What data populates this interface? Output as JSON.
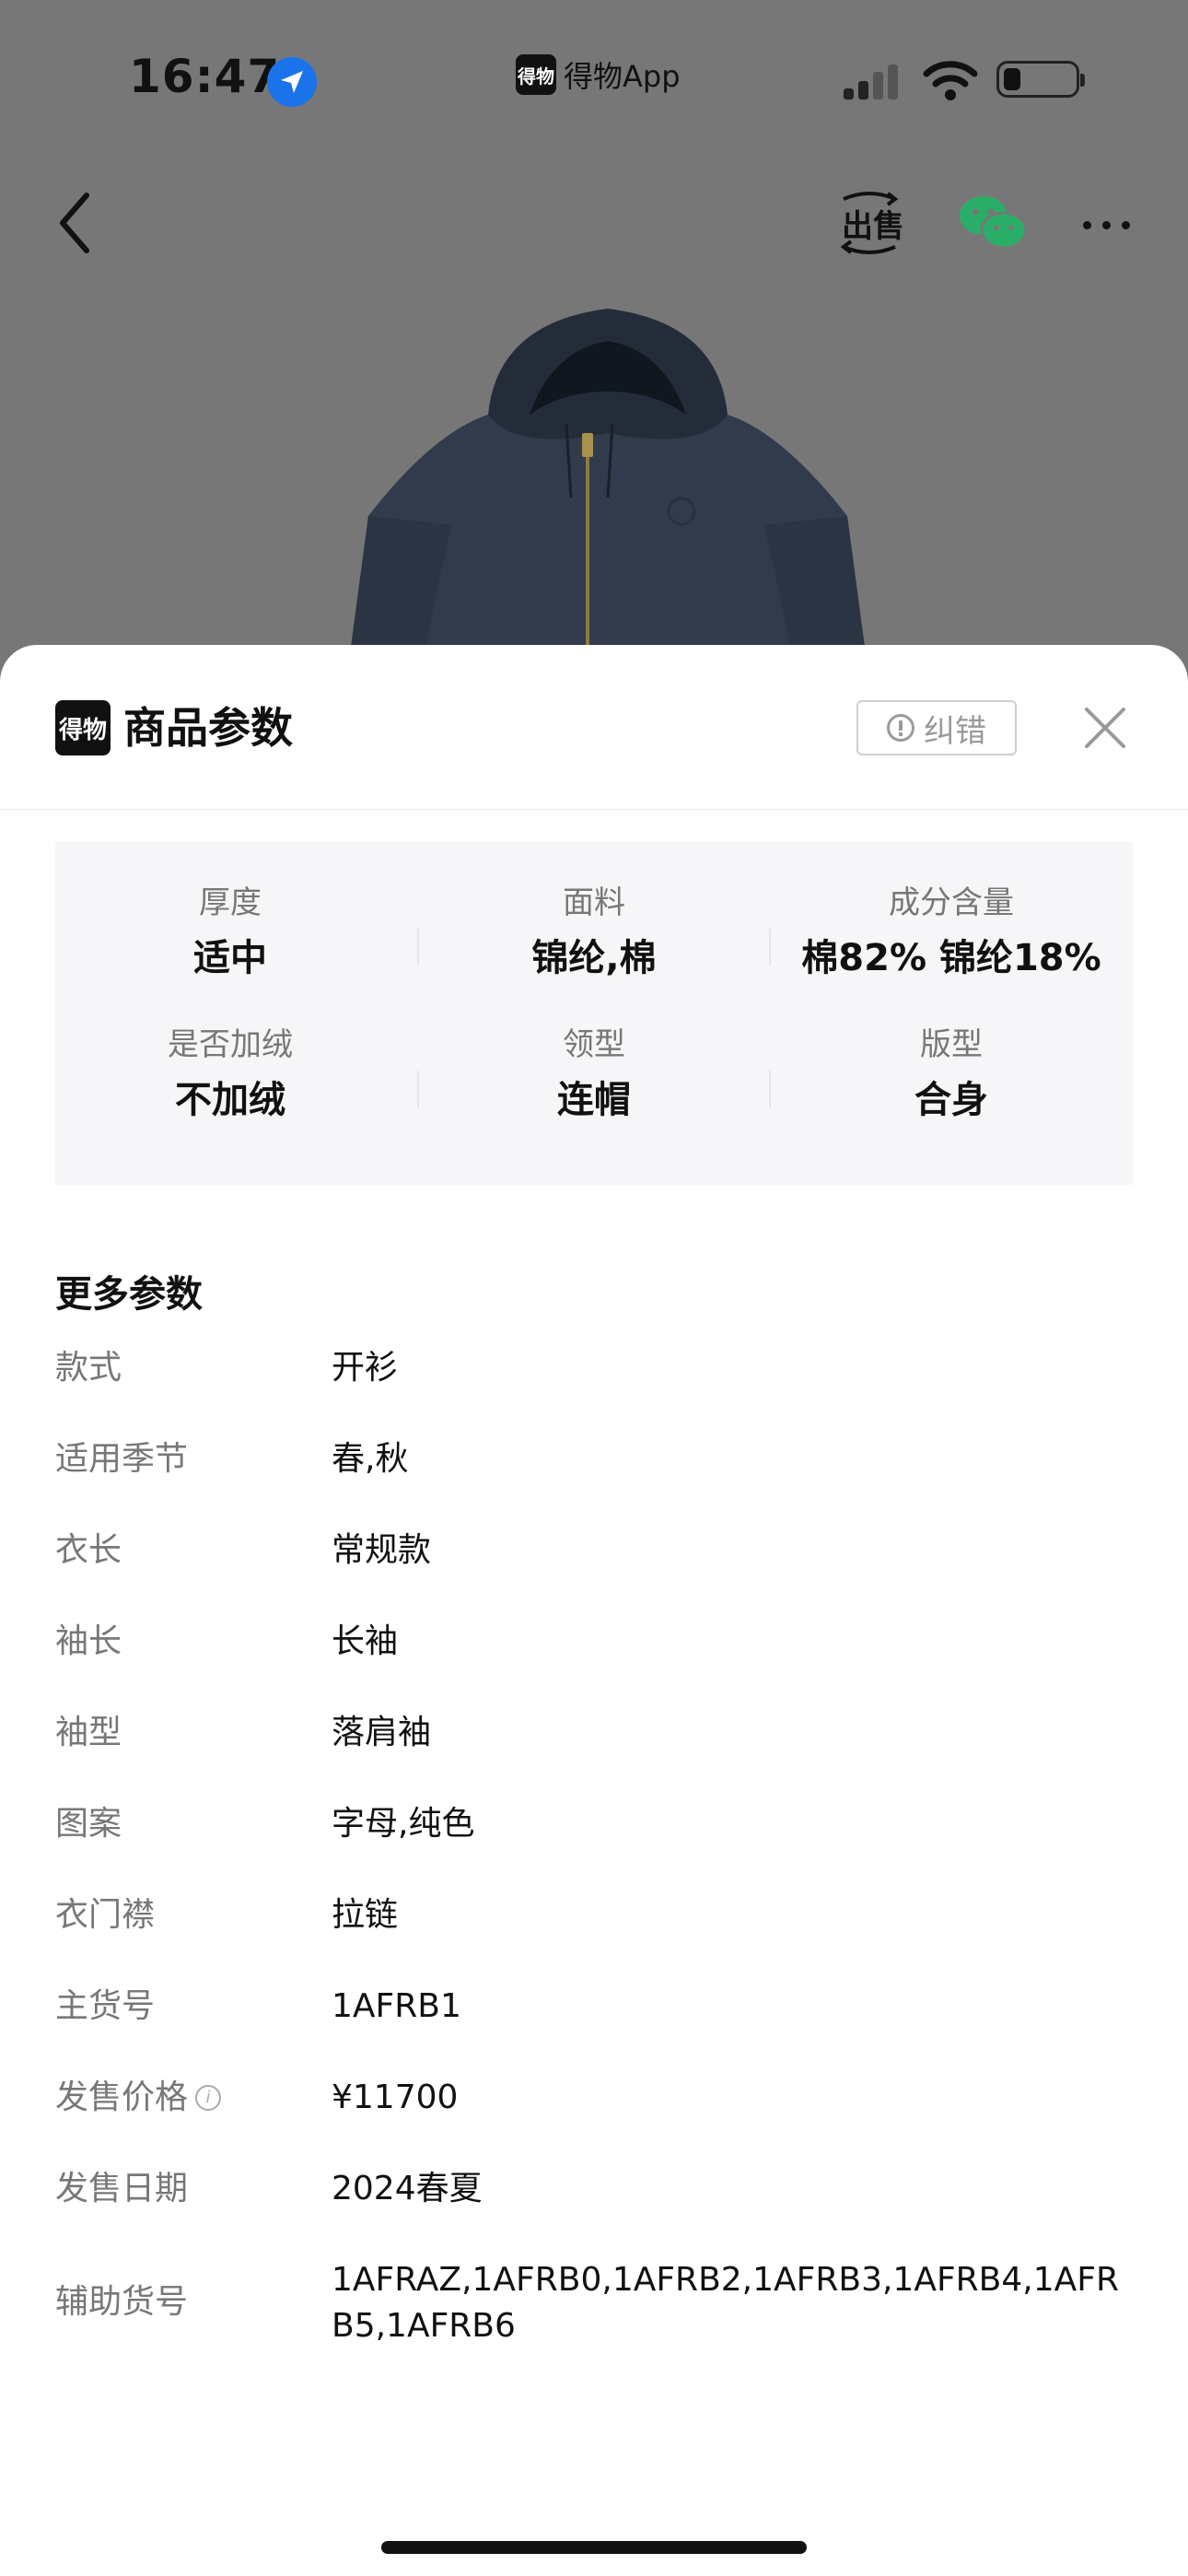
{
  "status_bar": {
    "time": "16:47",
    "app_badge_icon": "得物",
    "app_badge": "得物App"
  },
  "nav": {
    "sell_label": "出售"
  },
  "sheet": {
    "logo": "得物",
    "title": "商品参数",
    "report_label": "纠错"
  },
  "key_params": [
    {
      "label": "厚度",
      "value": "适中"
    },
    {
      "label": "面料",
      "value": "锦纶,棉"
    },
    {
      "label": "成分含量",
      "value": "棉82% 锦纶18%"
    },
    {
      "label": "是否加绒",
      "value": "不加绒"
    },
    {
      "label": "领型",
      "value": "连帽"
    },
    {
      "label": "版型",
      "value": "合身"
    }
  ],
  "more_title": "更多参数",
  "more_params": [
    {
      "label": "款式",
      "value": "开衫"
    },
    {
      "label": "适用季节",
      "value": "春,秋"
    },
    {
      "label": "衣长",
      "value": "常规款"
    },
    {
      "label": "袖长",
      "value": "长袖"
    },
    {
      "label": "袖型",
      "value": "落肩袖"
    },
    {
      "label": "图案",
      "value": "字母,纯色"
    },
    {
      "label": "衣门襟",
      "value": "拉链"
    },
    {
      "label": "主货号",
      "value": "1AFRB1"
    },
    {
      "label": "发售价格",
      "value": "¥11700"
    },
    {
      "label": "发售日期",
      "value": "2024春夏"
    },
    {
      "label": "辅助货号",
      "value": "1AFRAZ,1AFRB0,1AFRB2,1AFRB3,1AFRB4,1AFRB5,1AFRB6"
    }
  ],
  "icons": [
    "location-arrow-icon",
    "cellular-signal-icon",
    "wifi-icon",
    "battery-icon",
    "back-chevron-icon",
    "sell-icon",
    "wechat-icon",
    "more-dots-icon",
    "report-alert-icon",
    "close-icon",
    "info-icon"
  ],
  "colors": {
    "backdrop": "#777777",
    "sheet": "#ffffff",
    "panel": "#f6f6f8",
    "location_blue": "#1a73e8",
    "wechat_green": "#2aae67"
  }
}
